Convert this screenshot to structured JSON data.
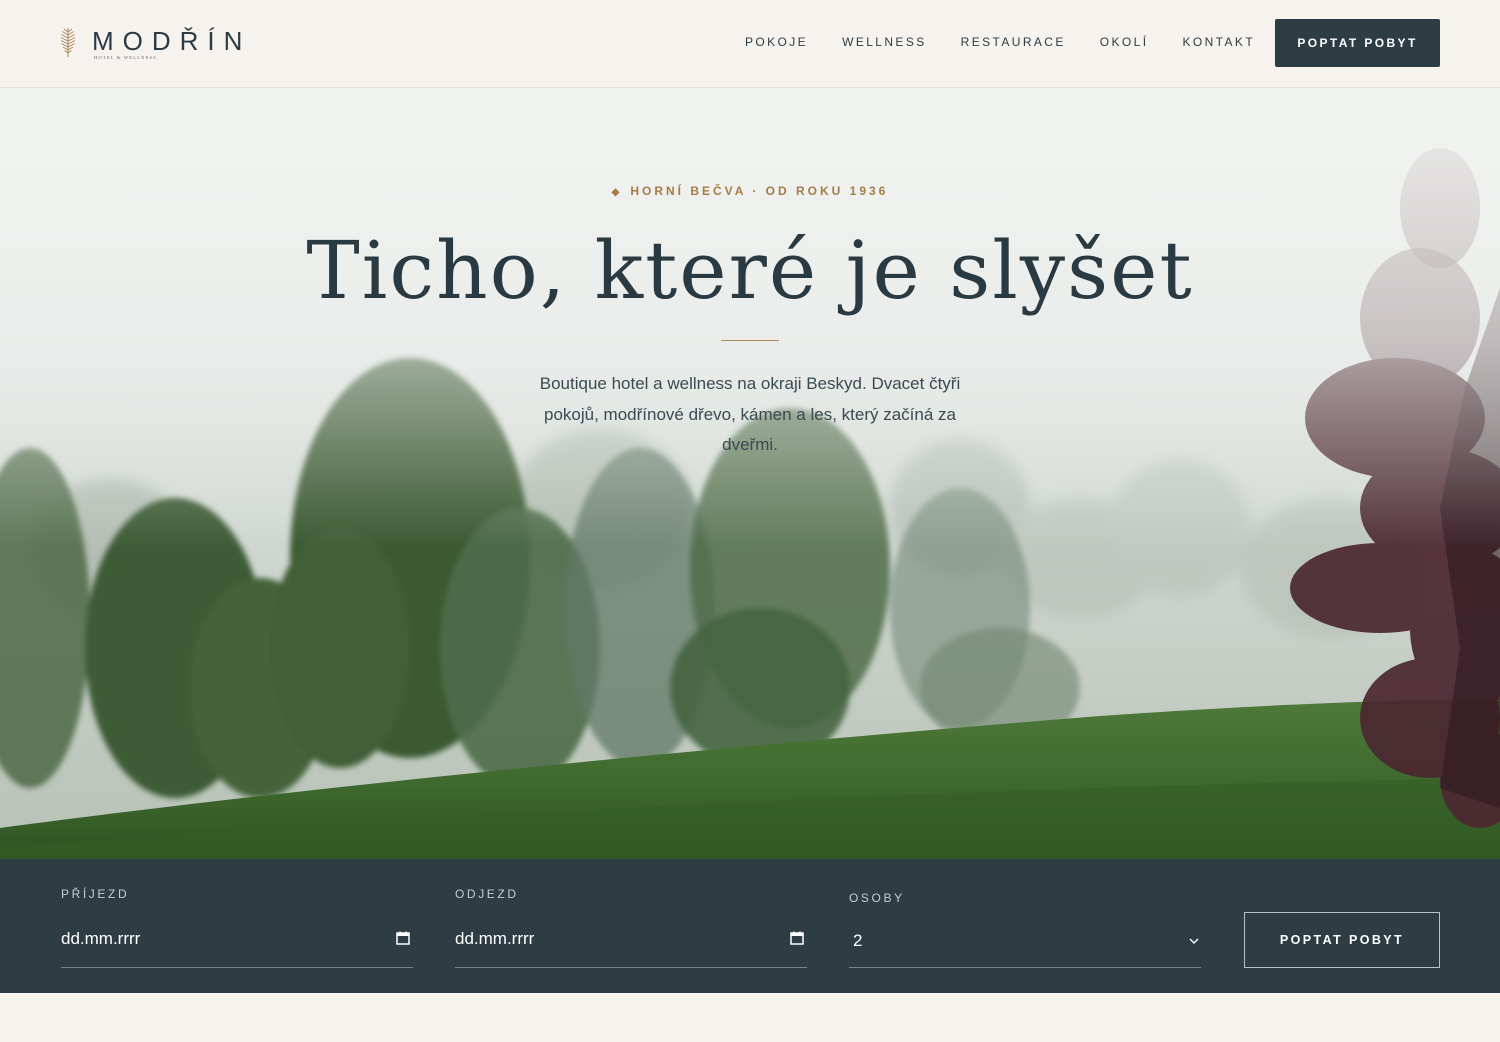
{
  "brand": {
    "name": "MODŘÍN",
    "tagline": "HOTEL & WELLNESS",
    "logo_icon": "larch-branch-icon"
  },
  "nav": {
    "items": [
      {
        "label": "POKOJE"
      },
      {
        "label": "WELLNESS"
      },
      {
        "label": "RESTAURACE"
      },
      {
        "label": "OKOLÍ"
      },
      {
        "label": "KONTAKT"
      }
    ],
    "cta_label": "POPTAT POBYT"
  },
  "hero": {
    "kicker": "HORNÍ BEČVA · OD ROKU 1936",
    "title": "Ticho, které je slyšet",
    "subtitle": "Boutique hotel a wellness na okraji Beskyd. Dvacet čtyři pokojů, modřínové dřevo, kámen a les, který začíná za dveřmi."
  },
  "booking": {
    "arrival": {
      "label": "PŘÍJEZD",
      "value": "dd.mm.rrrr"
    },
    "departure": {
      "label": "ODJEZD",
      "value": "dd.mm.rrrr"
    },
    "guests": {
      "label": "OSOBY",
      "value": "2"
    },
    "submit_label": "POPTAT POBYT"
  },
  "colors": {
    "page_bg": "#f6f3ee",
    "ink": "#2c3b43",
    "accent_gold": "#a67c45",
    "dark_slate": "#2e3c44"
  }
}
